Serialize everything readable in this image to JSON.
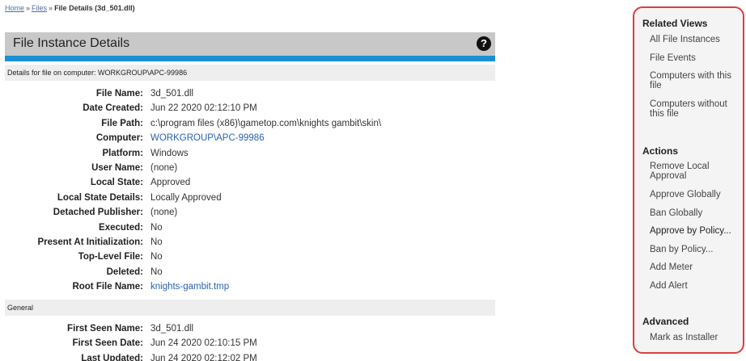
{
  "breadcrumb": {
    "home": "Home",
    "sep1": "»",
    "files": "Files",
    "sep2": "»",
    "current": "File Details (3d_501.dll)"
  },
  "header": {
    "title": "File Instance Details",
    "help": "?"
  },
  "sections": {
    "computer": "Details for file on computer: WORKGROUP\\APC-99986",
    "general": "General"
  },
  "details": [
    {
      "label": "File Name:",
      "value": "3d_501.dll",
      "link": false
    },
    {
      "label": "Date Created:",
      "value": "Jun 22 2020 02:12:10 PM",
      "link": false
    },
    {
      "label": "File Path:",
      "value": "c:\\program files (x86)\\gametop.com\\knights gambit\\skin\\",
      "link": false
    },
    {
      "label": "Computer:",
      "value": "WORKGROUP\\APC-99986",
      "link": true
    },
    {
      "label": "Platform:",
      "value": "Windows",
      "link": false
    },
    {
      "label": "User Name:",
      "value": "(none)",
      "link": false
    },
    {
      "label": "Local State:",
      "value": "Approved",
      "link": false
    },
    {
      "label": "Local State Details:",
      "value": "Locally Approved",
      "link": false
    },
    {
      "label": "Detached Publisher:",
      "value": "(none)",
      "link": false
    },
    {
      "label": "Executed:",
      "value": "No",
      "link": false
    },
    {
      "label": "Present At Initialization:",
      "value": "No",
      "link": false
    },
    {
      "label": "Top-Level File:",
      "value": "No",
      "link": false
    },
    {
      "label": "Deleted:",
      "value": "No",
      "link": false
    },
    {
      "label": "Root File Name:",
      "value": "knights-gambit.tmp",
      "link": true
    }
  ],
  "general": [
    {
      "label": "First Seen Name:",
      "value": "3d_501.dll",
      "link": false
    },
    {
      "label": "First Seen Date:",
      "value": "Jun 24 2020 02:10:15 PM",
      "link": false
    },
    {
      "label": "Last Updated:",
      "value": "Jun 24 2020 02:12:02 PM",
      "link": false
    }
  ],
  "sidebar": {
    "related_heading": "Related Views",
    "related": [
      "All File Instances",
      "File Events",
      "Computers with this file",
      "Computers without this file"
    ],
    "actions_heading": "Actions",
    "actions": [
      "Remove Local Approval",
      "Approve Globally",
      "Ban Globally",
      "Approve by Policy...",
      "Ban by Policy...",
      "Add Meter",
      "Add Alert"
    ],
    "advanced_heading": "Advanced",
    "advanced": [
      "Mark as Installer"
    ]
  },
  "colors": {
    "accent_blue": "#1a8fd6",
    "link": "#2a62b0",
    "sidebar_border": "#d93f3f"
  }
}
